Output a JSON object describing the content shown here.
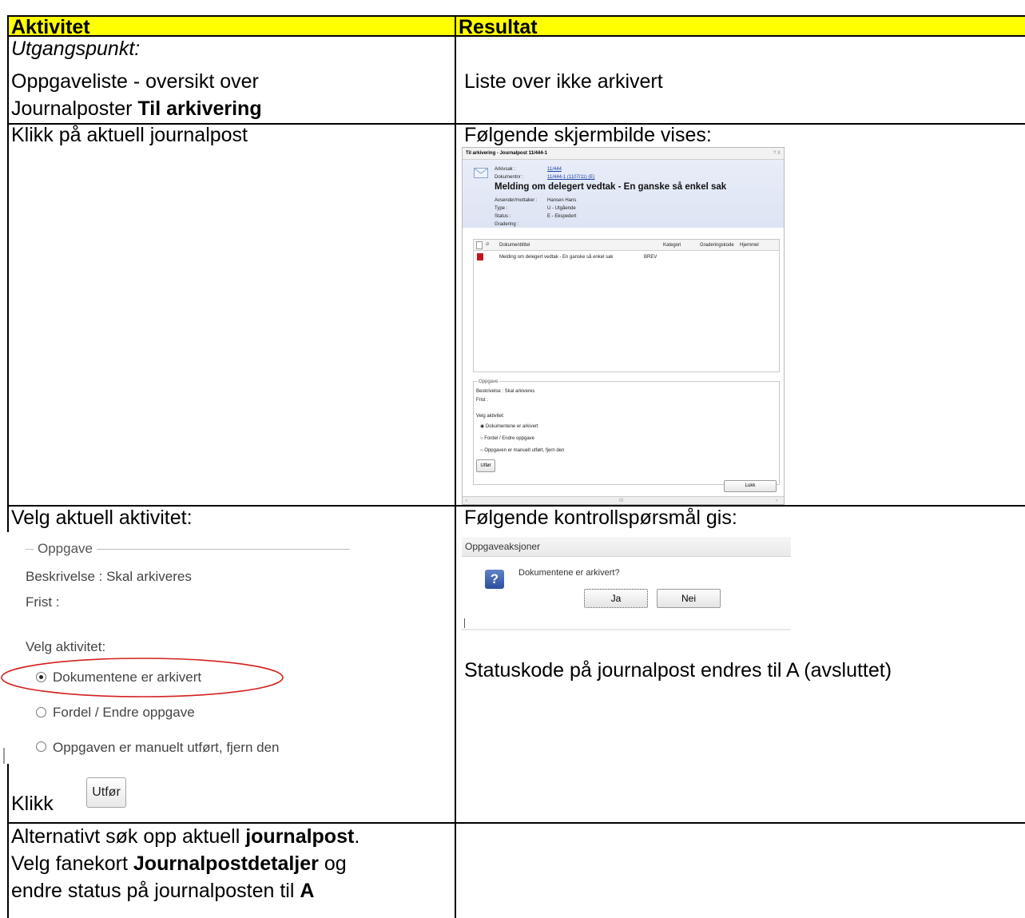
{
  "table": {
    "header_left": "Aktivitet",
    "header_right": "Resultat",
    "row1": {
      "left_line1": "Utgangspunkt:",
      "left_line2": "Oppgaveliste - oversikt over",
      "left_line3_a": "Journalposter ",
      "left_line3_b": "Til arkivering",
      "right": "Liste over ikke arkivert"
    },
    "row2": {
      "left": "Klikk på aktuell journalpost",
      "right": "Følgende skjermbilde vises:"
    },
    "row3": {
      "left": "Velg aktuell aktivitet:",
      "right": "Følgende kontrollspørsmål gis:",
      "right_status": "Statuskode på journalpost endres til A (avsluttet)",
      "left_klikk": "Klikk"
    },
    "row4": {
      "line1_a": "Alternativt søk opp aktuell ",
      "line1_b": "journalpost",
      "line1_c": ".",
      "line2_a": "Velg fanekort ",
      "line2_b": "Journalpostdetaljer",
      "line2_c": " og",
      "line3_a": "endre status på journalposten til ",
      "line3_b": "A"
    }
  },
  "dialog": {
    "title": "Til arkivering - Journalpost 11/444-1",
    "title_controls": "? X",
    "arkivsak_label": "Arkivsak :",
    "arkivsak_value": "11/444",
    "dokumentnr_label": "Dokumentnr :",
    "dokumentnr_value": "11/444-1 (1107/11) (E)",
    "heading": "Melding om delegert vedtak - En ganske så enkel sak",
    "avsender_label": "Avsender/mottaker :",
    "avsender_value": "Hansen Hans",
    "type_label": "Type :",
    "type_value": "U - Utgående",
    "status_label": "Status :",
    "status_value": "E - Ekspedert",
    "gradering_label": "Gradering :",
    "col_dokumenttittel": "Dokumenttittel",
    "col_kategori": "Kategori",
    "col_graderingskode": "Graderingskode",
    "col_hjemmel": "Hjemmel",
    "row_title": "Melding om delegert vedtak - En ganske så enkel sak",
    "row_kategori": "BREV",
    "opp_legend": "Oppgave",
    "opp_beskrivelse": "Beskrivelse : Skal arkiveres",
    "opp_frist": "Frist :",
    "opp_velg": "Velg aktivitet:",
    "opt1": "Dokumentene er arkivert",
    "opt2": "Fordel / Endre oppgave",
    "opt3": "Oppgaven er manuelt utført, fjern den",
    "utfor": "Utfør",
    "lukk": "Lukk",
    "scroll_mid": "III"
  },
  "confirm": {
    "title": "Oppgaveaksjoner",
    "question": "Dokumentene er arkivert?",
    "ja": "Ja",
    "nei": "Nei"
  },
  "panel": {
    "legend": "Oppgave",
    "beskrivelse": "Beskrivelse : Skal arkiveres",
    "frist": "Frist :",
    "velg": "Velg aktivitet:",
    "opt1": "Dokumentene er arkivert",
    "opt2": "Fordel / Endre oppgave",
    "opt3": "Oppgaven er manuelt utført, fjern den",
    "utfor": "Utfør"
  }
}
